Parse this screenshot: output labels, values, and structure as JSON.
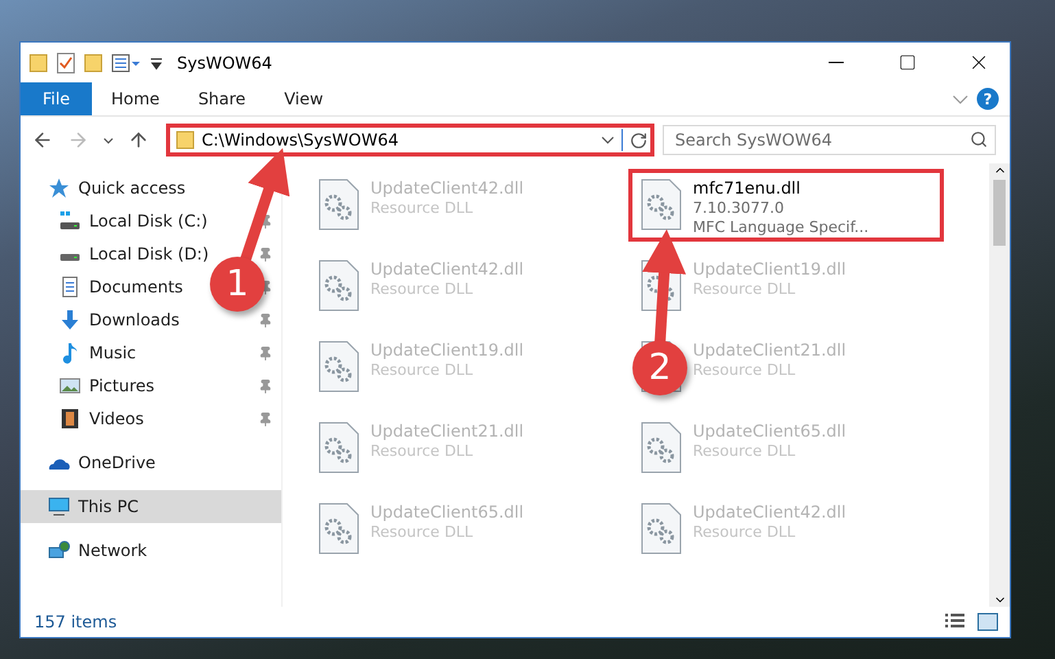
{
  "window": {
    "title": "SysWOW64"
  },
  "ribbon": {
    "tabs": [
      {
        "label": "File",
        "selected": true
      },
      {
        "label": "Home",
        "selected": false
      },
      {
        "label": "Share",
        "selected": false
      },
      {
        "label": "View",
        "selected": false
      }
    ],
    "help": "?"
  },
  "address": {
    "path": "C:\\Windows\\SysWOW64",
    "highlighted": true
  },
  "search": {
    "placeholder": "Search SysWOW64"
  },
  "sidebar": {
    "items": [
      {
        "label": "Quick access",
        "kind": "star",
        "selected": false,
        "children": [
          {
            "label": "Local Disk (C:)",
            "kind": "sysdrive",
            "pinned": true,
            "selected": false
          },
          {
            "label": "Local Disk (D:)",
            "kind": "drive",
            "pinned": true,
            "selected": false
          },
          {
            "label": "Documents",
            "kind": "documents",
            "pinned": true,
            "selected": false
          },
          {
            "label": "Downloads",
            "kind": "downloads",
            "pinned": true,
            "selected": false
          },
          {
            "label": "Music",
            "kind": "music",
            "pinned": true,
            "selected": false
          },
          {
            "label": "Pictures",
            "kind": "pictures",
            "pinned": true,
            "selected": false
          },
          {
            "label": "Videos",
            "kind": "videos",
            "pinned": true,
            "selected": false
          }
        ]
      },
      {
        "label": "OneDrive",
        "kind": "cloud",
        "selected": false
      },
      {
        "label": "This PC",
        "kind": "pc",
        "selected": true
      },
      {
        "label": "Network",
        "kind": "network",
        "selected": false
      }
    ]
  },
  "files": [
    {
      "name": "UpdateClient42.dll",
      "detail": [
        "Resource DLL"
      ],
      "faded": true,
      "highlighted": false
    },
    {
      "name": "mfc71enu.dll",
      "detail": [
        "7.10.3077.0",
        "MFC Language Specif..."
      ],
      "faded": false,
      "highlighted": true
    },
    {
      "name": "UpdateClient42.dll",
      "detail": [
        "Resource DLL"
      ],
      "faded": true,
      "highlighted": false
    },
    {
      "name": "UpdateClient19.dll",
      "detail": [
        "Resource DLL"
      ],
      "faded": true,
      "highlighted": false
    },
    {
      "name": "UpdateClient19.dll",
      "detail": [
        "Resource DLL"
      ],
      "faded": true,
      "highlighted": false
    },
    {
      "name": "UpdateClient21.dll",
      "detail": [
        "Resource DLL"
      ],
      "faded": true,
      "highlighted": false
    },
    {
      "name": "UpdateClient21.dll",
      "detail": [
        "Resource DLL"
      ],
      "faded": true,
      "highlighted": false
    },
    {
      "name": "UpdateClient65.dll",
      "detail": [
        "Resource DLL"
      ],
      "faded": true,
      "highlighted": false
    },
    {
      "name": "UpdateClient65.dll",
      "detail": [
        "Resource DLL"
      ],
      "faded": true,
      "highlighted": false
    },
    {
      "name": "UpdateClient42.dll",
      "detail": [
        "Resource DLL"
      ],
      "faded": true,
      "highlighted": false
    }
  ],
  "status_bar": {
    "count": "157 items"
  },
  "annotations": [
    {
      "number": "1"
    },
    {
      "number": "2"
    }
  ]
}
